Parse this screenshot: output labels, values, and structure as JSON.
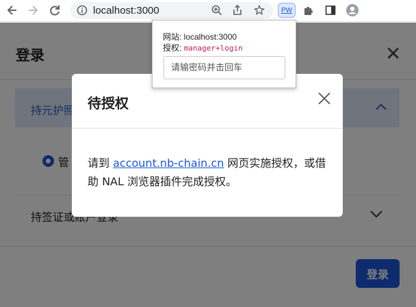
{
  "browser": {
    "url": "localhost:3000",
    "extension_badge": "PW"
  },
  "page": {
    "login_title": "登录",
    "login_close": "✕",
    "accordion1_label": "持元护照",
    "radio_label": "管",
    "accordion2_label": "持签证或账户登录",
    "login_button": "登录"
  },
  "modal": {
    "title": "待授权",
    "body_prefix": "请到 ",
    "link_text": "account.nb-chain.cn",
    "body_suffix": " 网页实施授权，或借助 NAL 浏览器插件完成授权。"
  },
  "popup": {
    "site_label": "网站: ",
    "site_value": "localhost:3000",
    "auth_label": "授权: ",
    "auth_value": "manager+login",
    "password_placeholder": "请输密码并击回车"
  },
  "colors": {
    "accent": "#1a56db",
    "overlay": "rgba(0,0,0,0.5)"
  }
}
